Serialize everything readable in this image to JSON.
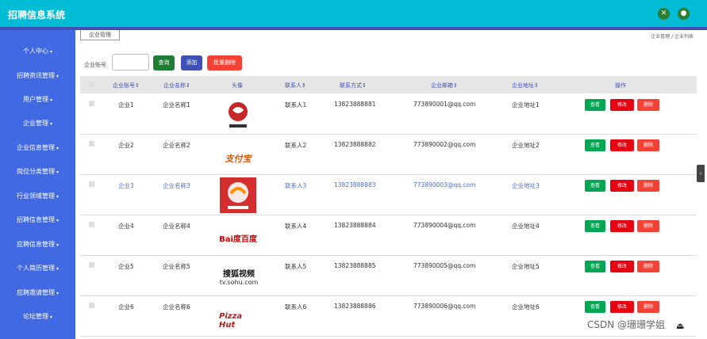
{
  "app": {
    "title": "招聘信息系统",
    "icon_left": "close-icon",
    "icon_right": "user-icon",
    "icon_color": "#2e7d32",
    "topbar_color": "#00bcd4",
    "sidebar_color": "#4169e1"
  },
  "sidebar": {
    "items": [
      {
        "label": "个人中心",
        "arrow": true
      },
      {
        "label": "招聘资讯管理",
        "arrow": true
      },
      {
        "label": "用户管理",
        "arrow": true
      },
      {
        "label": "企业管理",
        "arrow": true
      },
      {
        "label": "企业信息管理",
        "arrow": true
      },
      {
        "label": "岗位分类管理",
        "arrow": true
      },
      {
        "label": "行业领域管理",
        "arrow": true
      },
      {
        "label": "招聘信息管理",
        "arrow": true
      },
      {
        "label": "应聘信息管理",
        "arrow": true
      },
      {
        "label": "个人简历管理",
        "arrow": true
      },
      {
        "label": "应聘邀请管理",
        "arrow": true
      },
      {
        "label": "论坛管理",
        "arrow": true
      }
    ]
  },
  "tab": {
    "label": "企业管理"
  },
  "breadcrumb": {
    "text": "企业管理 / 企业列表"
  },
  "search": {
    "label": "企业账号",
    "value": "",
    "placeholder": ""
  },
  "toolbar": {
    "search": "查询",
    "add": "添加",
    "batch_delete": "批量删除"
  },
  "table": {
    "headers": [
      "企业账号",
      "企业名称",
      "头像",
      "联系人",
      "联系方式",
      "企业邮箱",
      "企业地址",
      "操作"
    ],
    "rows": [
      {
        "account": "企业1",
        "name": "企业名称1",
        "logo": "restaurant-logo",
        "contact": "联系人1",
        "phone": "13823888881",
        "email": "773890001@qq.com",
        "address": "企业地址1"
      },
      {
        "account": "企业2",
        "name": "企业名称2",
        "logo": "taobao-logo",
        "logo_text": "支付宝",
        "contact": "联系人2",
        "phone": "13823888882",
        "email": "773890002@qq.com",
        "address": "企业地址2"
      },
      {
        "account": "企业3",
        "name": "企业名称3",
        "logo": "food-logo",
        "contact": "联系人3",
        "phone": "13823888883",
        "email": "773890003@qq.com",
        "address": "企业地址3"
      },
      {
        "account": "企业4",
        "name": "企业名称4",
        "logo": "baidu-logo",
        "logo_text": "Bai度百度",
        "contact": "联系人4",
        "phone": "13823888884",
        "email": "773890004@qq.com",
        "address": "企业地址4"
      },
      {
        "account": "企业5",
        "name": "企业名称5",
        "logo": "sohu-logo",
        "logo_text": "搜狐视频",
        "logo_sub": "tv.sohu.com",
        "contact": "联系人5",
        "phone": "13823888885",
        "email": "773890005@qq.com",
        "address": "企业地址5"
      },
      {
        "account": "企业6",
        "name": "企业名称6",
        "logo": "pizzahut-logo",
        "logo_text": "Pizza Hut",
        "contact": "联系人6",
        "phone": "13823888886",
        "email": "773890006@qq.com",
        "address": "企业地址6"
      }
    ],
    "actions": {
      "view": "查看",
      "edit": "修改",
      "delete": "删除"
    }
  },
  "watermark": {
    "text": "CSDN @珊珊学姐"
  }
}
